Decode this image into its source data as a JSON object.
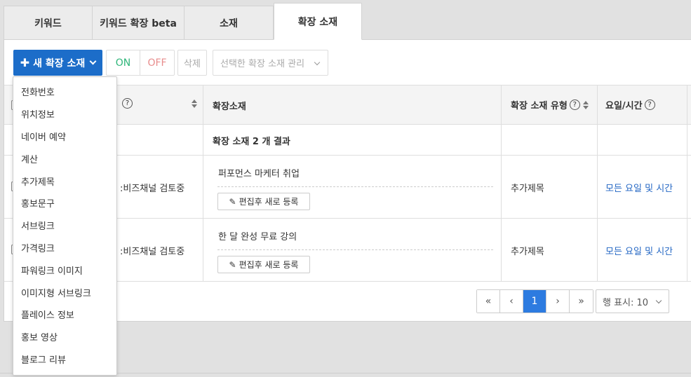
{
  "tabs": [
    {
      "label": "키워드"
    },
    {
      "label": "키워드 확장 beta"
    },
    {
      "label": "소재"
    },
    {
      "label": "확장 소재",
      "active": true
    }
  ],
  "toolbar": {
    "new_label": "새 확장 소재",
    "on_label": "ON",
    "off_label": "OFF",
    "delete_label": "삭제",
    "manage_label": "선택한 확장 소재 관리"
  },
  "table": {
    "headers": {
      "ad": "확장소재",
      "type": "확장 소재 유형",
      "schedule": "요일/시간",
      "help": "?"
    },
    "summary": "확장 소재 2 개 결과",
    "rows": [
      {
        "status": ":비즈채널 검토중",
        "ad_text": "퍼포먼스 마케터 취업",
        "edit_label": "편집후 새로 등록",
        "type": "추가제목",
        "schedule": "모든 요일 및 시간"
      },
      {
        "status": ":비즈채널 검토중",
        "ad_text": "한 달 완성 무료 강의",
        "edit_label": "편집후 새로 등록",
        "type": "추가제목",
        "schedule": "모든 요일 및 시간"
      }
    ]
  },
  "pagination": {
    "first": "«",
    "prev": "‹",
    "current": "1",
    "next": "›",
    "last": "»",
    "rows_label": "행 표시: 10"
  },
  "dropdown": {
    "items": [
      "전화번호",
      "위치정보",
      "네이버 예약",
      "계산",
      "추가제목",
      "홍보문구",
      "서브링크",
      "가격링크",
      "파워링크 이미지",
      "이미지형 서브링크",
      "플레이스 정보",
      "홍보 영상",
      "블로그 리뷰"
    ]
  },
  "colors": {
    "primary": "#1c6dc9",
    "on": "#2fb67a",
    "off": "#e88d8d",
    "link": "#2467c4",
    "page_active": "#2d7be0"
  }
}
